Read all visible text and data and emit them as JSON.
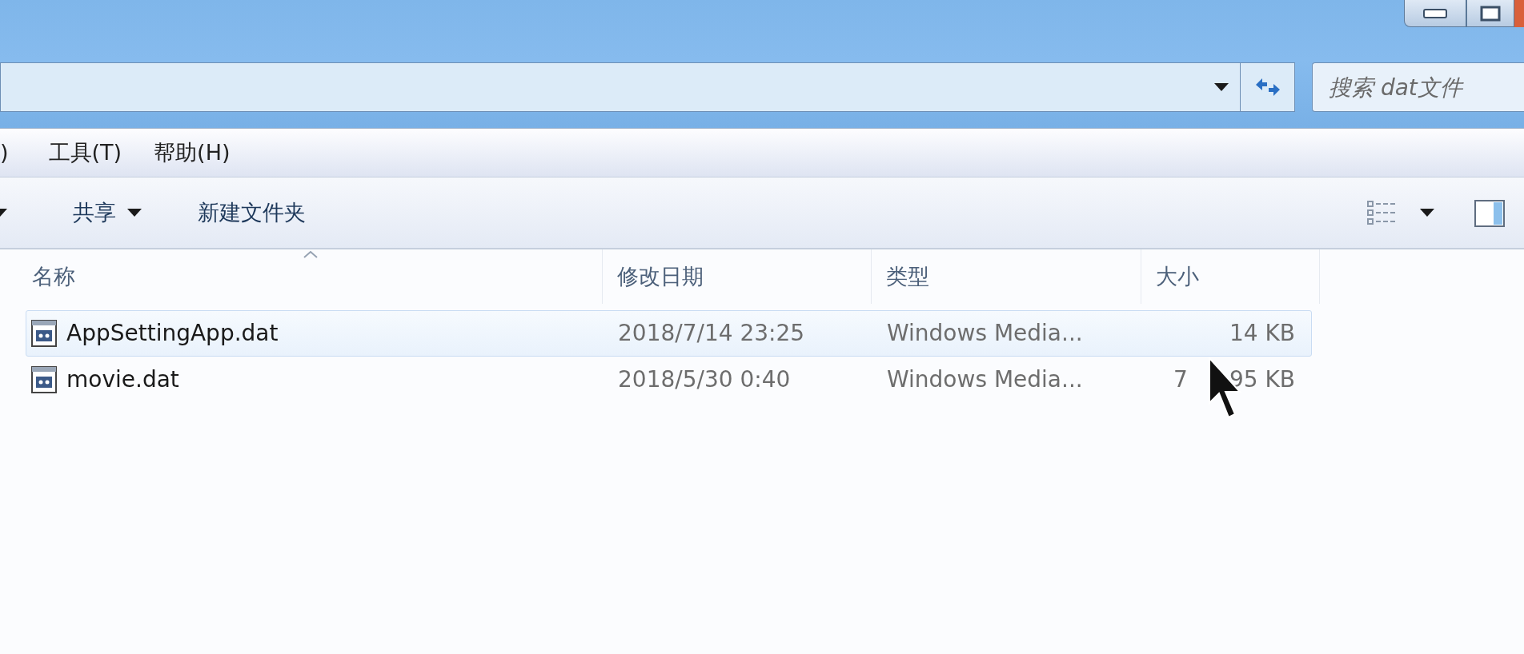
{
  "address_bar": {
    "search_placeholder": "搜索 dat文件"
  },
  "menu": [
    {
      "label": ")"
    },
    {
      "label": "工具(T)"
    },
    {
      "label": "帮助(H)"
    }
  ],
  "toolbar": {
    "buttons": [
      {
        "label": "共享",
        "dropdown": true
      },
      {
        "label": "新建文件夹",
        "dropdown": false
      }
    ]
  },
  "table": {
    "columns": [
      {
        "label": "名称",
        "sorted": true
      },
      {
        "label": "修改日期",
        "sorted": false
      },
      {
        "label": "类型",
        "sorted": false
      },
      {
        "label": "大小",
        "sorted": false
      }
    ],
    "rows": [
      {
        "name": "AppSettingApp.dat",
        "date": "2018/7/14 23:25",
        "type": "Windows Media...",
        "size": "14 KB",
        "selected": true
      },
      {
        "name": "movie.dat",
        "date": "2018/5/30 0:40",
        "type": "Windows Media...",
        "size": "7",
        "size_tail": "95 KB",
        "selected": false
      }
    ]
  }
}
